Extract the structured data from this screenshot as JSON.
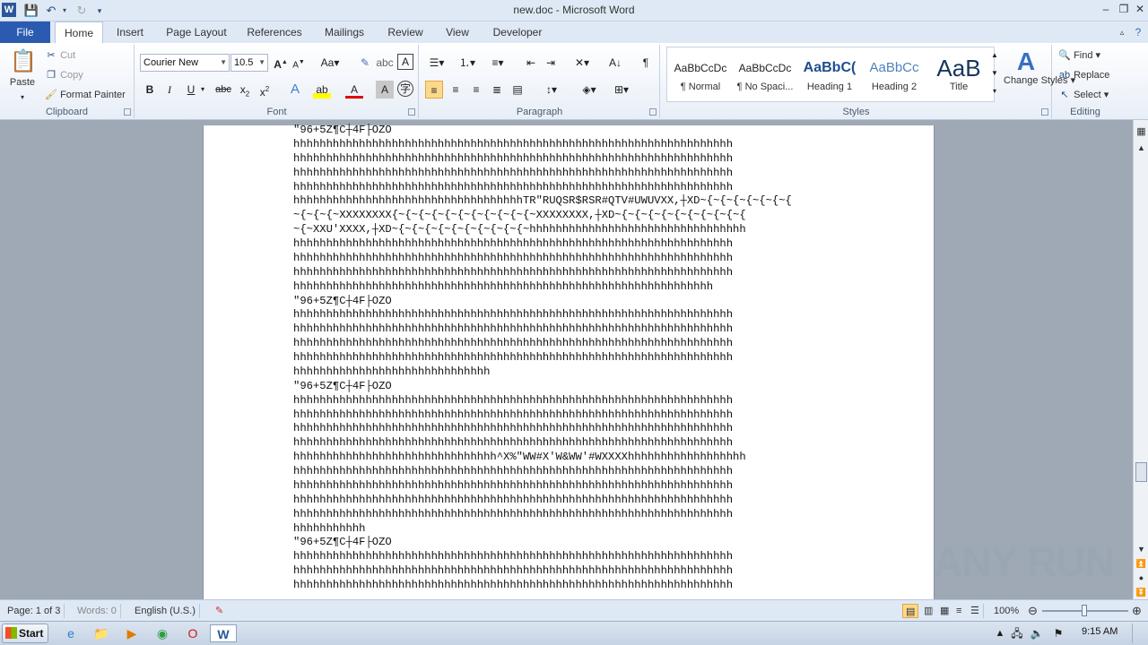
{
  "window": {
    "title": "new.doc - Microsoft Word"
  },
  "tabs": [
    "File",
    "Home",
    "Insert",
    "Page Layout",
    "References",
    "Mailings",
    "Review",
    "View",
    "Developer"
  ],
  "clipboard": {
    "paste": "Paste",
    "cut": "Cut",
    "copy": "Copy",
    "format_painter": "Format Painter",
    "label": "Clipboard"
  },
  "font": {
    "name": "Courier New",
    "size": "10.5",
    "label": "Font"
  },
  "paragraph": {
    "label": "Paragraph"
  },
  "styles": {
    "items": [
      {
        "preview": "AaBbCcDc",
        "name": "¶ Normal"
      },
      {
        "preview": "AaBbCcDc",
        "name": "¶ No Spaci..."
      },
      {
        "preview": "AaBbC(",
        "name": "Heading 1"
      },
      {
        "preview": "AaBbCc",
        "name": "Heading 2"
      },
      {
        "preview": "AaB",
        "name": "Title"
      }
    ],
    "change_styles": "Change Styles",
    "label": "Styles"
  },
  "editing": {
    "find": "Find",
    "replace": "Replace",
    "select": "Select",
    "label": "Editing"
  },
  "document_lines": [
    "\"96+5Z¶C┼4F├OZO",
    "hhhhhhhhhhhhhhhhhhhhhhhhhhhhhhhhhhhhhhhhhhhhhhhhhhhhhhhhhhhhhhhhhhh",
    "hhhhhhhhhhhhhhhhhhhhhhhhhhhhhhhhhhhhhhhhhhhhhhhhhhhhhhhhhhhhhhhhhhh",
    "hhhhhhhhhhhhhhhhhhhhhhhhhhhhhhhhhhhhhhhhhhhhhhhhhhhhhhhhhhhhhhhhhhh",
    "hhhhhhhhhhhhhhhhhhhhhhhhhhhhhhhhhhhhhhhhhhhhhhhhhhhhhhhhhhhhhhhhhhh",
    "hhhhhhhhhhhhhhhhhhhhhhhhhhhhhhhhhhhTR\"RUQSR$RSR#QTV#UWUVXX,┼XD~{~{~{~{~{~{~{",
    "~{~{~{~XXXXXXXX{~{~{~{~{~{~{~{~{~{~{~XXXXXXXX,┼XD~{~{~{~{~{~{~{~{~{~{",
    "~{~XXU'XXXX,┼XD~{~{~{~{~{~{~{~{~{~{~hhhhhhhhhhhhhhhhhhhhhhhhhhhhhhhhh",
    "hhhhhhhhhhhhhhhhhhhhhhhhhhhhhhhhhhhhhhhhhhhhhhhhhhhhhhhhhhhhhhhhhhh",
    "hhhhhhhhhhhhhhhhhhhhhhhhhhhhhhhhhhhhhhhhhhhhhhhhhhhhhhhhhhhhhhhhhhh",
    "hhhhhhhhhhhhhhhhhhhhhhhhhhhhhhhhhhhhhhhhhhhhhhhhhhhhhhhhhhhhhhhhhhh",
    "hhhhhhhhhhhhhhhhhhhhhhhhhhhhhhhhhhhhhhhhhhhhhhhhhhhhhhhhhhhhhhhh",
    "\"96+5Z¶C┼4F├OZO",
    "hhhhhhhhhhhhhhhhhhhhhhhhhhhhhhhhhhhhhhhhhhhhhhhhhhhhhhhhhhhhhhhhhhh",
    "hhhhhhhhhhhhhhhhhhhhhhhhhhhhhhhhhhhhhhhhhhhhhhhhhhhhhhhhhhhhhhhhhhh",
    "hhhhhhhhhhhhhhhhhhhhhhhhhhhhhhhhhhhhhhhhhhhhhhhhhhhhhhhhhhhhhhhhhhh",
    "hhhhhhhhhhhhhhhhhhhhhhhhhhhhhhhhhhhhhhhhhhhhhhhhhhhhhhhhhhhhhhhhhhh",
    "hhhhhhhhhhhhhhhhhhhhhhhhhhhhhh",
    "\"96+5Z¶C┼4F├OZO",
    "hhhhhhhhhhhhhhhhhhhhhhhhhhhhhhhhhhhhhhhhhhhhhhhhhhhhhhhhhhhhhhhhhhh",
    "hhhhhhhhhhhhhhhhhhhhhhhhhhhhhhhhhhhhhhhhhhhhhhhhhhhhhhhhhhhhhhhhhhh",
    "hhhhhhhhhhhhhhhhhhhhhhhhhhhhhhhhhhhhhhhhhhhhhhhhhhhhhhhhhhhhhhhhhhh",
    "hhhhhhhhhhhhhhhhhhhhhhhhhhhhhhhhhhhhhhhhhhhhhhhhhhhhhhhhhhhhhhhhhhh",
    "hhhhhhhhhhhhhhhhhhhhhhhhhhhhhhh^X%\"WW#X'W&WW'#WXXXXhhhhhhhhhhhhhhhhhh",
    "hhhhhhhhhhhhhhhhhhhhhhhhhhhhhhhhhhhhhhhhhhhhhhhhhhhhhhhhhhhhhhhhhhh",
    "hhhhhhhhhhhhhhhhhhhhhhhhhhhhhhhhhhhhhhhhhhhhhhhhhhhhhhhhhhhhhhhhhhh",
    "hhhhhhhhhhhhhhhhhhhhhhhhhhhhhhhhhhhhhhhhhhhhhhhhhhhhhhhhhhhhhhhhhhh",
    "hhhhhhhhhhhhhhhhhhhhhhhhhhhhhhhhhhhhhhhhhhhhhhhhhhhhhhhhhhhhhhhhhhh",
    "hhhhhhhhhhh",
    "\"96+5Z¶C┼4F├OZO",
    "hhhhhhhhhhhhhhhhhhhhhhhhhhhhhhhhhhhhhhhhhhhhhhhhhhhhhhhhhhhhhhhhhhh",
    "hhhhhhhhhhhhhhhhhhhhhhhhhhhhhhhhhhhhhhhhhhhhhhhhhhhhhhhhhhhhhhhhhhh",
    "hhhhhhhhhhhhhhhhhhhhhhhhhhhhhhhhhhhhhhhhhhhhhhhhhhhhhhhhhhhhhhhhhhh"
  ],
  "status": {
    "page": "Page: 1 of 3",
    "words": "Words: 0",
    "language": "English (U.S.)",
    "zoom": "100%"
  },
  "taskbar": {
    "start": "Start",
    "clock": "9:15 AM"
  },
  "watermark": "ANY RUN",
  "colors": {
    "file_tab": "#2a5bb0",
    "ribbon_bg": "#dfe9f5",
    "doc_bg": "#9fa9b5"
  }
}
